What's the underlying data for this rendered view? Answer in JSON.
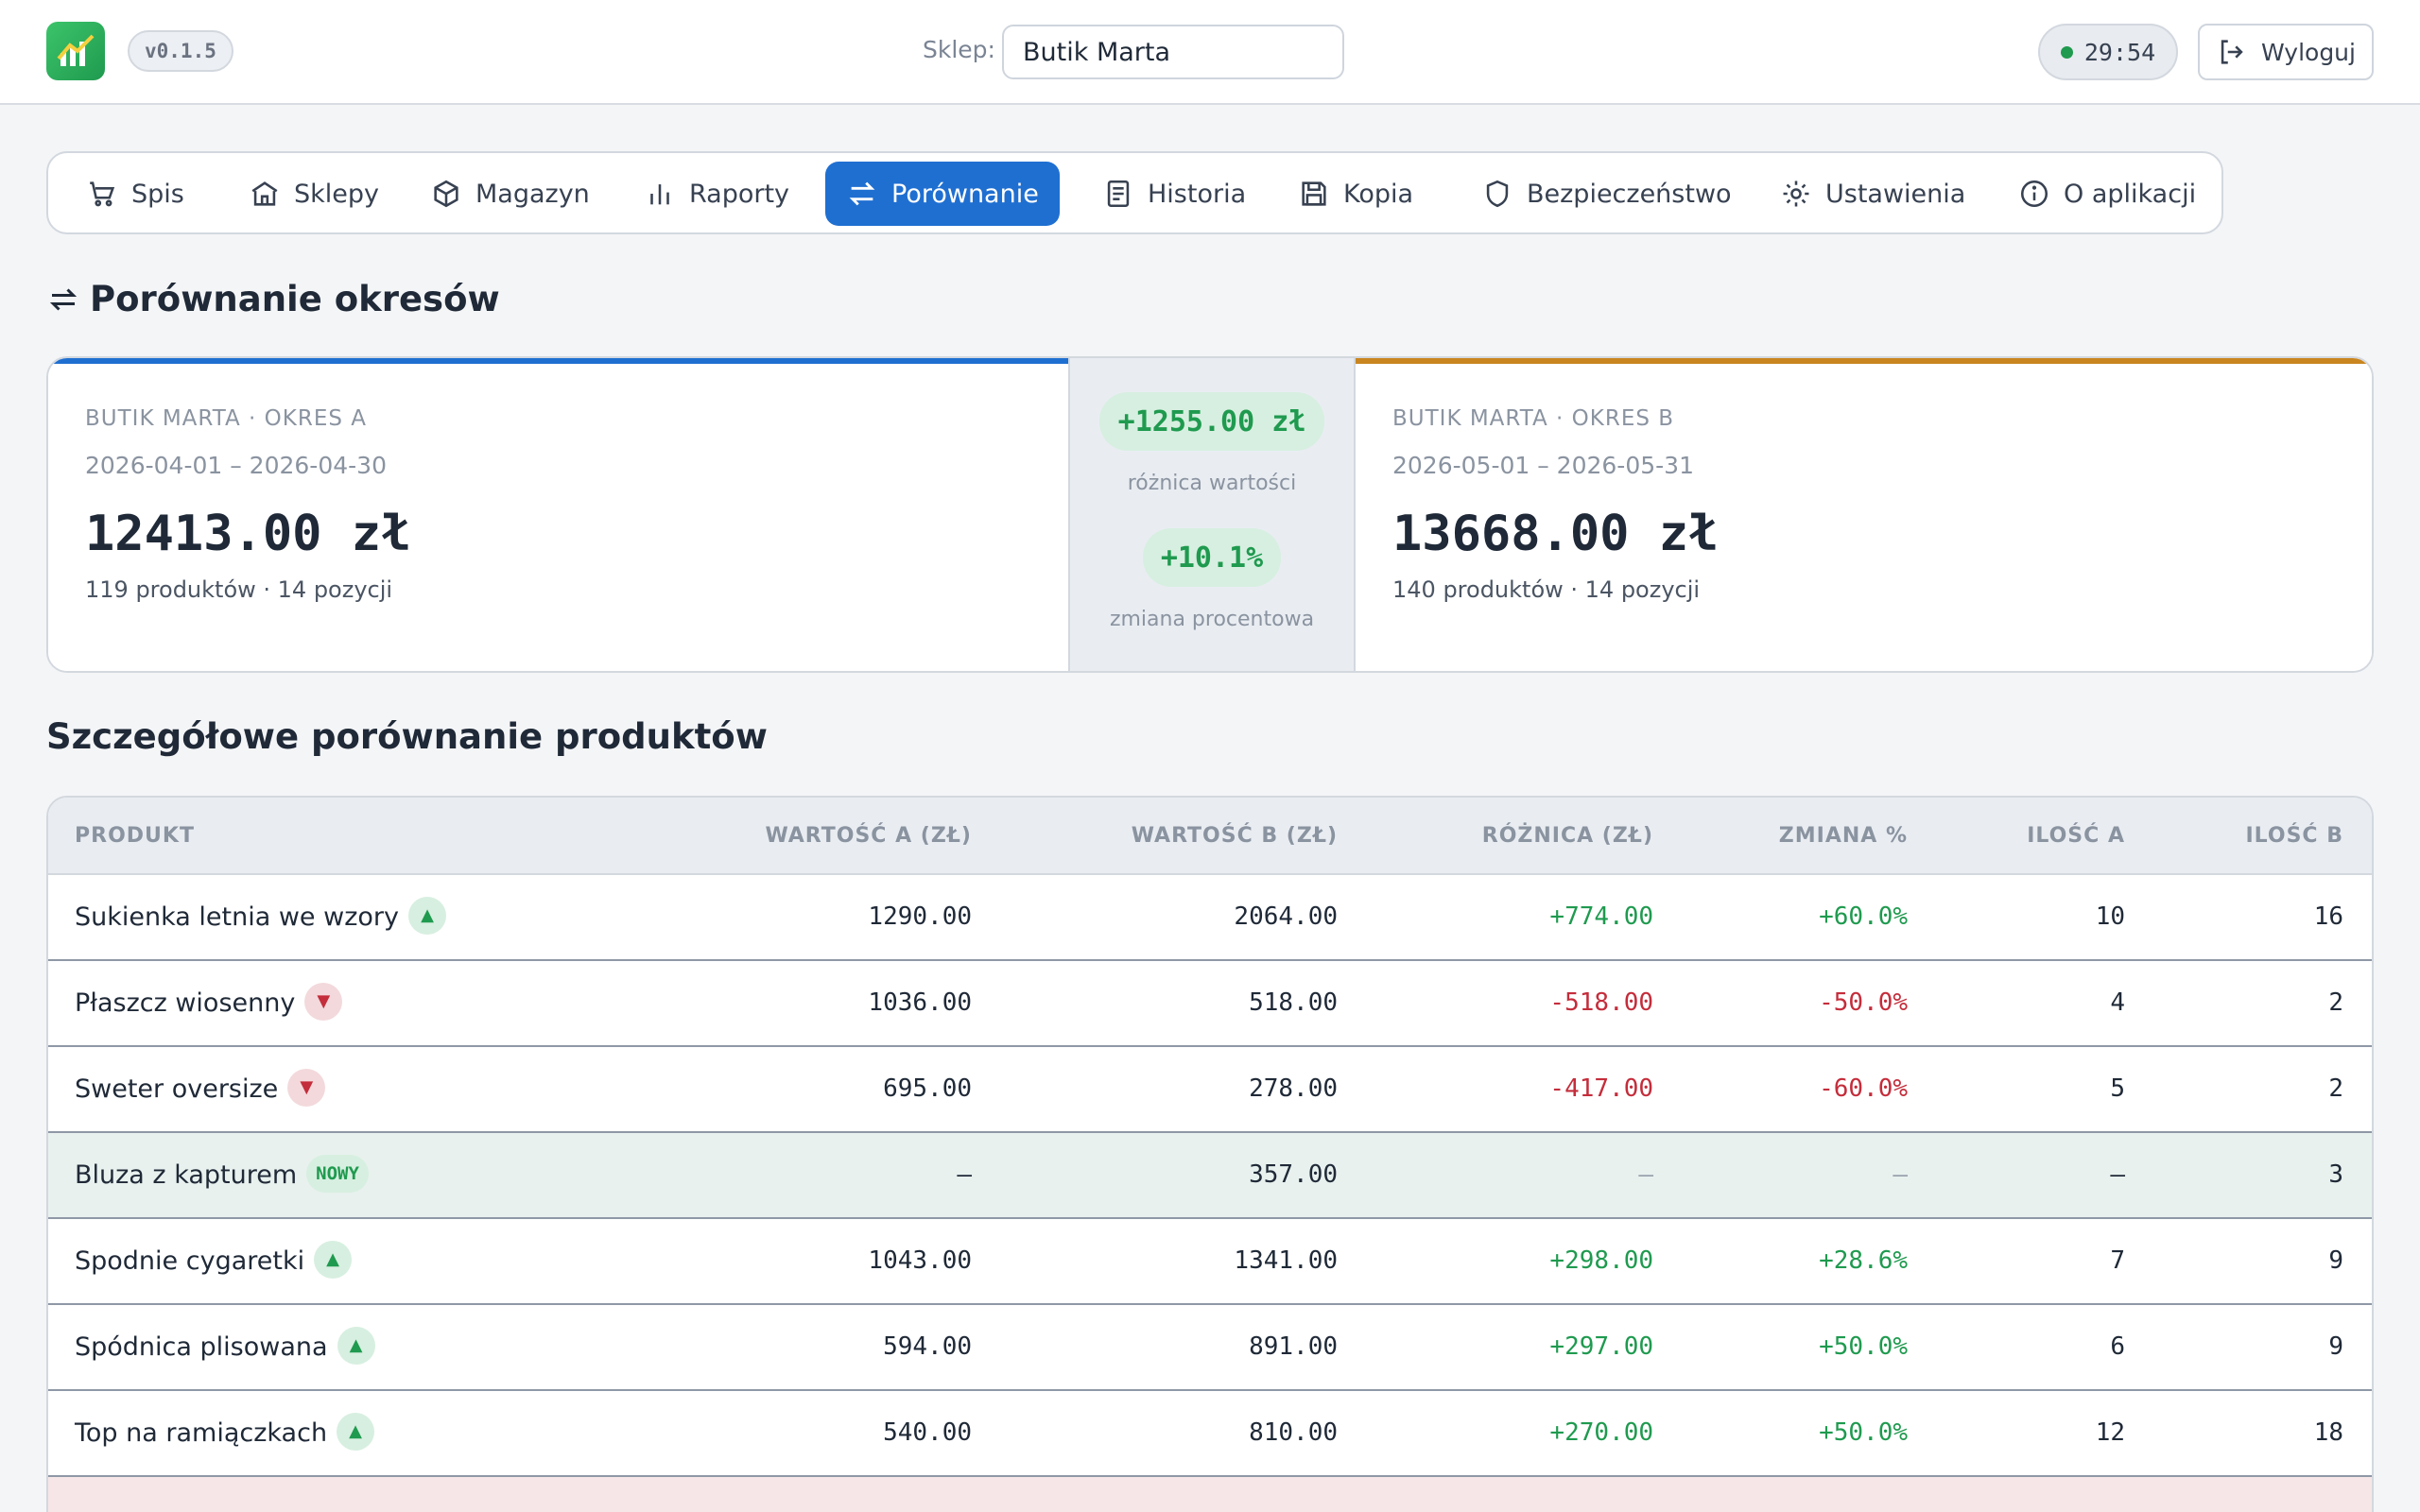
{
  "header": {
    "version": "v0.1.5",
    "store_label": "Sklep:",
    "store_value": "Butik Marta",
    "timer": "29:54",
    "logout_label": "Wyloguj"
  },
  "nav": {
    "items": [
      {
        "label": "Spis",
        "icon": "cart-icon"
      },
      {
        "label": "Sklepy",
        "icon": "store-icon"
      },
      {
        "label": "Magazyn",
        "icon": "box-icon"
      },
      {
        "label": "Raporty",
        "icon": "bar-chart-icon"
      },
      {
        "label": "Porównanie",
        "icon": "swap-icon",
        "active": true
      },
      {
        "label": "Historia",
        "icon": "document-icon"
      },
      {
        "label": "Kopia",
        "icon": "save-icon"
      },
      {
        "label": "Bezpieczeństwo",
        "icon": "shield-icon"
      },
      {
        "label": "Ustawienia",
        "icon": "gear-icon"
      },
      {
        "label": "O aplikacji",
        "icon": "info-icon"
      }
    ]
  },
  "page": {
    "title": "Porównanie okresów"
  },
  "compare": {
    "a": {
      "label": "BUTIK MARTA · OKRES A",
      "dates": "2026-04-01 – 2026-04-30",
      "value": "12413.00 zł",
      "summary": "119 produktów · 14 pozycji"
    },
    "b": {
      "label": "BUTIK MARTA · OKRES B",
      "dates": "2026-05-01 – 2026-05-31",
      "value": "13668.00 zł",
      "summary": "140 produktów · 14 pozycji"
    },
    "diff_value": "+1255.00 zł",
    "diff_value_caption": "różnica wartości",
    "diff_percent": "+10.1%",
    "diff_percent_caption": "zmiana procentowa"
  },
  "table": {
    "title": "Szczegółowe porównanie produktów",
    "headers": {
      "product": "PRODUKT",
      "value_a": "WARTOŚĆ A (ZŁ)",
      "value_b": "WARTOŚĆ B (ZŁ)",
      "diff": "RÓŻNICA (ZŁ)",
      "change": "ZMIANA %",
      "qty_a": "ILOŚĆ A",
      "qty_b": "ILOŚĆ B"
    },
    "rows": [
      {
        "name": "Sukienka letnia we wzory",
        "trend": "up",
        "badge": "",
        "value_a": "1290.00",
        "value_b": "2064.00",
        "diff": "+774.00",
        "change": "+60.0%",
        "qty_a": "10",
        "qty_b": "16",
        "status": "pos"
      },
      {
        "name": "Płaszcz wiosenny",
        "trend": "down",
        "badge": "",
        "value_a": "1036.00",
        "value_b": "518.00",
        "diff": "-518.00",
        "change": "-50.0%",
        "qty_a": "4",
        "qty_b": "2",
        "status": "neg"
      },
      {
        "name": "Sweter oversize",
        "trend": "down",
        "badge": "",
        "value_a": "695.00",
        "value_b": "278.00",
        "diff": "-417.00",
        "change": "-60.0%",
        "qty_a": "5",
        "qty_b": "2",
        "status": "neg"
      },
      {
        "name": "Bluza z kapturem",
        "trend": "",
        "badge": "NOWY",
        "value_a": "–",
        "value_b": "357.00",
        "diff": "–",
        "change": "–",
        "qty_a": "–",
        "qty_b": "3",
        "status": "new"
      },
      {
        "name": "Spodnie cygaretki",
        "trend": "up",
        "badge": "",
        "value_a": "1043.00",
        "value_b": "1341.00",
        "diff": "+298.00",
        "change": "+28.6%",
        "qty_a": "7",
        "qty_b": "9",
        "status": "pos"
      },
      {
        "name": "Spódnica plisowana",
        "trend": "up",
        "badge": "",
        "value_a": "594.00",
        "value_b": "891.00",
        "diff": "+297.00",
        "change": "+50.0%",
        "qty_a": "6",
        "qty_b": "9",
        "status": "pos"
      },
      {
        "name": "Top na ramiączkach",
        "trend": "up",
        "badge": "",
        "value_a": "540.00",
        "value_b": "810.00",
        "diff": "+270.00",
        "change": "+50.0%",
        "qty_a": "12",
        "qty_b": "18",
        "status": "pos"
      }
    ]
  }
}
